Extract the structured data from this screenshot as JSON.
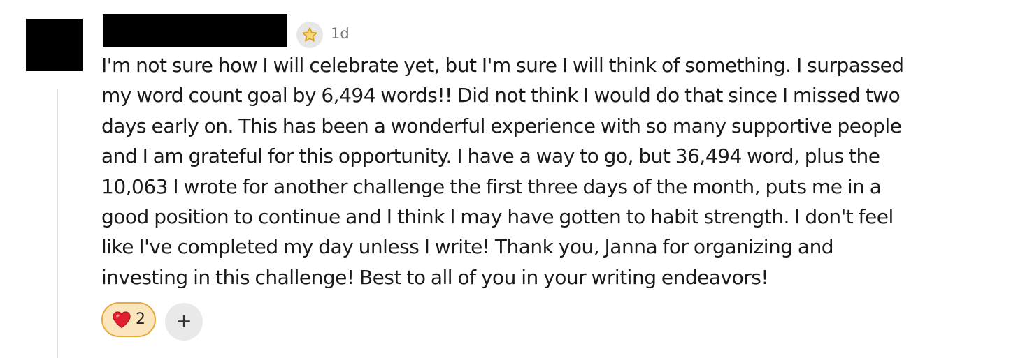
{
  "comment": {
    "timestamp": "1d",
    "badge_icon": "star-icon",
    "body_lines": [
      "I'm not sure how I will celebrate yet, but I'm sure I will think of something.  I surpassed",
      "my word count goal by 6,494 words!!  Did not think I would do that since I missed two",
      "days early on.  This has been a wonderful experience with so many supportive people",
      "and I am grateful for this opportunity.  I have a way to go, but 36,494 word, plus the",
      "10,063 I wrote for another challenge the first three days of the month, puts me in a",
      "good position to continue and I think I may have gotten to habit strength.  I don't feel",
      "like I've completed my day unless I write!  Thank you, Janna for organizing and",
      "investing in this challenge!  Best to all of you in your writing endeavors!"
    ]
  },
  "reactions": {
    "items": [
      {
        "icon": "heart-icon",
        "count": "2",
        "active": true
      }
    ],
    "add_label": "+"
  },
  "colors": {
    "heart": "#e0202e",
    "reaction_active_border": "#e8a83a",
    "reaction_active_bg": "#fbe5bd",
    "thread_line": "#dcdcdc"
  }
}
